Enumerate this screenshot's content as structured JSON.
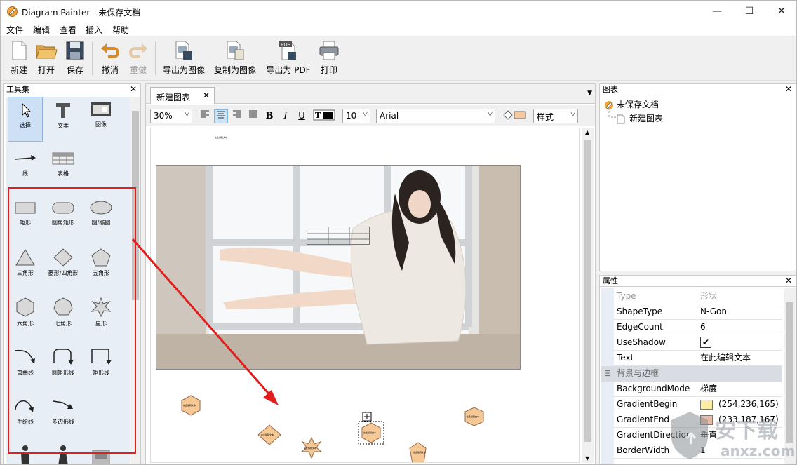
{
  "app": {
    "title": "Diagram Painter - 未保存文档"
  },
  "window_controls": {
    "minimize": "—",
    "maximize": "☐",
    "close": "✕"
  },
  "menu": [
    "文件",
    "编辑",
    "查看",
    "插入",
    "帮助"
  ],
  "toolbar": {
    "new": "新建",
    "open": "打开",
    "save": "保存",
    "undo": "撤消",
    "redo": "重做",
    "export_image": "导出为图像",
    "copy_image": "复制为图像",
    "export_pdf": "导出为 PDF",
    "print": "打印",
    "pdf_badge": "PDF"
  },
  "toolbox": {
    "title": "工具集",
    "close": "✕",
    "items": [
      {
        "label": "选择",
        "icon": "cursor-icon",
        "selected": true
      },
      {
        "label": "文本",
        "icon": "text-icon"
      },
      {
        "label": "图像",
        "icon": "image-icon"
      },
      {
        "label": "线",
        "icon": "line-arrow-icon"
      },
      {
        "label": "表格",
        "icon": "table-icon"
      },
      {
        "label": "矩形",
        "icon": "rectangle-icon"
      },
      {
        "label": "圆角矩形",
        "icon": "rounded-rectangle-icon"
      },
      {
        "label": "圆/椭圆",
        "icon": "ellipse-icon"
      },
      {
        "label": "三角形",
        "icon": "triangle-icon"
      },
      {
        "label": "菱形/四角形",
        "icon": "diamond-icon"
      },
      {
        "label": "五角形",
        "icon": "pentagon-icon"
      },
      {
        "label": "六角形",
        "icon": "hexagon-icon"
      },
      {
        "label": "七角形",
        "icon": "heptagon-icon"
      },
      {
        "label": "星形",
        "icon": "star-icon"
      },
      {
        "label": "弯曲线",
        "icon": "curved-line-icon"
      },
      {
        "label": "圆矩形线",
        "icon": "round-rect-line-icon"
      },
      {
        "label": "矩形线",
        "icon": "rect-line-icon"
      },
      {
        "label": "手绘线",
        "icon": "freehand-line-icon"
      },
      {
        "label": "多边形线",
        "icon": "polyline-icon"
      }
    ]
  },
  "document": {
    "tab": "新建图表",
    "tab_close": "✕",
    "zoom": "30%",
    "font_size": "10",
    "font_name": "Arial",
    "style": "样式",
    "format_buttons": {
      "bold": "B",
      "italic": "I",
      "underline": "U"
    },
    "shape_text": "在此编辑文本",
    "canvas_title_text": "在此编辑文本"
  },
  "chart_panel": {
    "title": "图表",
    "close": "✕",
    "root": "未保存文档",
    "child": "新建图表"
  },
  "properties": {
    "title": "属性",
    "close": "✕",
    "rows": [
      {
        "key": "Type",
        "value": "形状",
        "dim": true
      },
      {
        "key": "ShapeType",
        "value": "N-Gon"
      },
      {
        "key": "EdgeCount",
        "value": "6"
      },
      {
        "key": "UseShadow",
        "value": "✔"
      },
      {
        "key": "Text",
        "value": "在此编辑文本"
      }
    ],
    "section": "背景与边框",
    "section_toggle": "⊟",
    "rows2": [
      {
        "key": "BackgroundMode",
        "value": "梯度"
      },
      {
        "key": "GradientBegin",
        "value": "(254,236,165)",
        "color": "#feeca5"
      },
      {
        "key": "GradientEnd",
        "value": "(233,187,167)",
        "color": "#e9bba7"
      },
      {
        "key": "GradientDirection",
        "value": "垂直"
      },
      {
        "key": "BorderWidth",
        "value": "1"
      }
    ]
  },
  "watermark": {
    "brand": "安下载",
    "site": "anxz.com"
  },
  "colors": {
    "annotation_red": "#e21d1d",
    "shape_fill": "#f5c896",
    "shape_stroke": "#9a6a4a",
    "selected_tool": "#cde0f5"
  }
}
